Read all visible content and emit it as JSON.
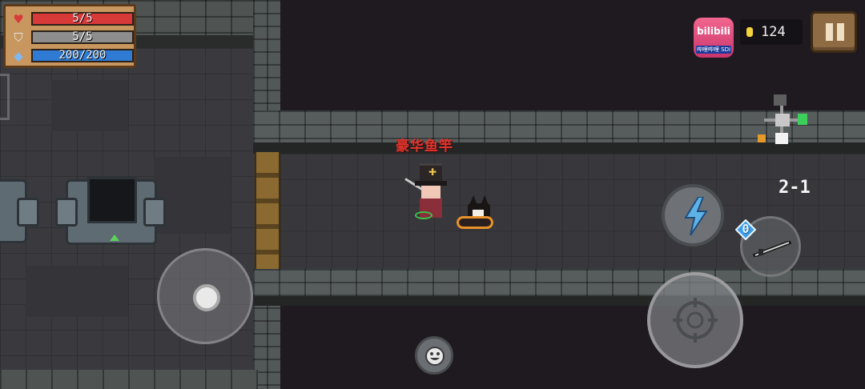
{
  "hud": {
    "health": {
      "value": "5/5",
      "fraction": 1.0,
      "color": "#d83a3a",
      "icon": "heart-icon"
    },
    "armor": {
      "value": "5/5",
      "fraction": 1.0,
      "color": "#8d8d8d",
      "icon": "shield-icon"
    },
    "energy": {
      "value": "200/200",
      "fraction": 1.0,
      "color": "#2f7bd3",
      "icon": "diamond-icon"
    },
    "coins": "124",
    "level": "2-1"
  },
  "badge": {
    "brand": "bilibili",
    "band_text": "哔哩哔哩 SDI"
  },
  "scene": {
    "item_label": "豪华鱼竿"
  },
  "controls": {
    "weapon_energy_cost": "0"
  },
  "colors": {
    "item_label": "#e1352d",
    "skill_bolt": "#5fb2e8",
    "pause_bg": "#8f6b43"
  }
}
